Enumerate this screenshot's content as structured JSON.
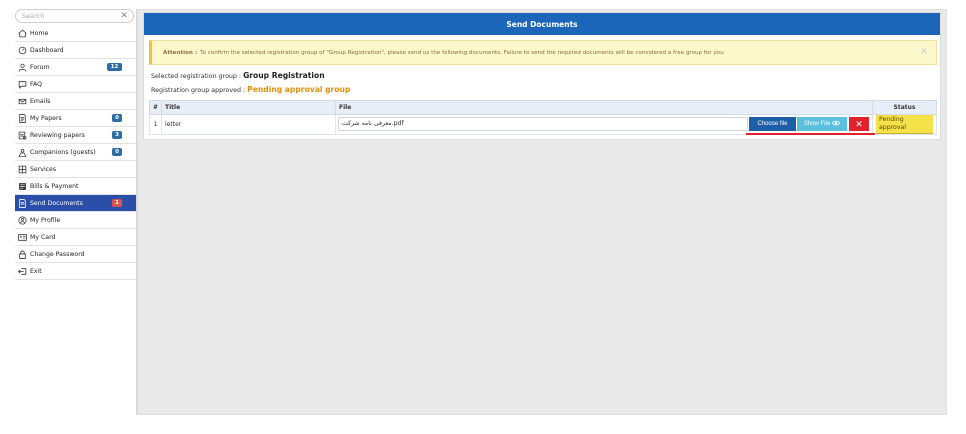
{
  "sidebar": {
    "search_placeholder": "Search",
    "items": [
      {
        "label": "Home",
        "icon": "home-icon"
      },
      {
        "label": "Dashboard",
        "icon": "dashboard-icon"
      },
      {
        "label": "Forum",
        "icon": "user-icon",
        "badge": "12"
      },
      {
        "label": "FAQ",
        "icon": "chat-icon"
      },
      {
        "label": "Emails",
        "icon": "mail-icon"
      },
      {
        "label": "My Papers",
        "icon": "paper-icon",
        "badge": "0"
      },
      {
        "label": "Reviewing papers",
        "icon": "review-icon",
        "badge": "3"
      },
      {
        "label": "Companions (guests)",
        "icon": "group-icon",
        "badge": "0"
      },
      {
        "label": "Services",
        "icon": "services-icon"
      },
      {
        "label": "Bills & Payment",
        "icon": "bill-icon"
      },
      {
        "label": "Send Documents",
        "icon": "document-icon",
        "badge": "1",
        "active": true
      },
      {
        "label": "My Profile",
        "icon": "profile-icon"
      },
      {
        "label": "My Card",
        "icon": "card-icon"
      },
      {
        "label": "Change Password",
        "icon": "lock-icon"
      },
      {
        "label": "Exit",
        "icon": "exit-icon"
      }
    ]
  },
  "panel": {
    "title": "Send Documents",
    "alert_label": "Attention :",
    "alert_text": "To confirm the selected registration group of \"Group Registration\", please send us the following documents. Failure to send the required documents will be considered a free group for you",
    "selected_label": "Selected registration group :",
    "selected_value": "Group Registration",
    "approved_label": "Registration group approved :",
    "approved_value": "Pending approval group"
  },
  "table": {
    "headers": {
      "num": "#",
      "title": "Title",
      "file": "File",
      "status": "Status"
    },
    "rows": [
      {
        "num": "1",
        "title": "letter",
        "file": "معرفی نامه شرکت.pdf",
        "choose": "Choose file",
        "show": "Show File",
        "delete": "✕",
        "status": "Pending approval"
      }
    ]
  },
  "colors": {
    "header_blue": "#1c66b9",
    "active_nav": "#2b4fa8",
    "badge_blue": "#2e6da4",
    "badge_red": "#d9534f",
    "alert_bg": "#fcf8cb",
    "pending_orange": "#e58f0b",
    "delete_red": "#e0222e"
  }
}
